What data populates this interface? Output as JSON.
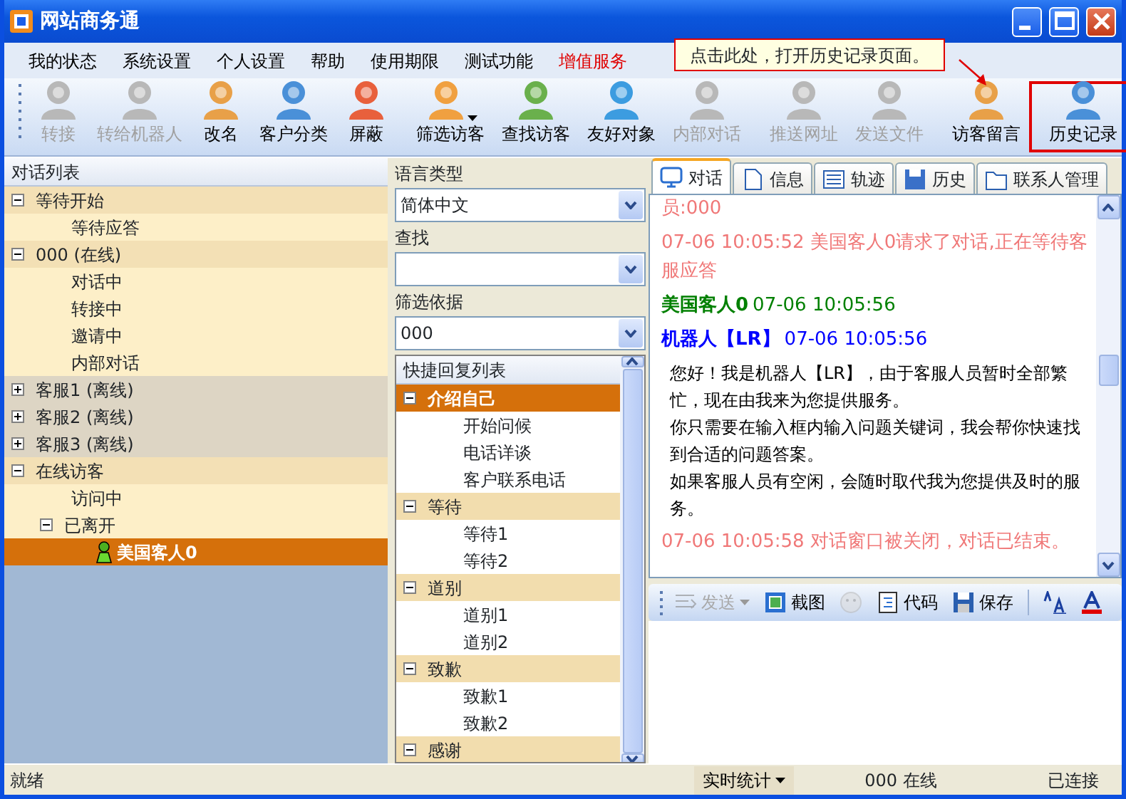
{
  "window": {
    "title": "网站商务通"
  },
  "menu": [
    {
      "label": "我的状态",
      "promoted": false
    },
    {
      "label": "系统设置",
      "promoted": false
    },
    {
      "label": "个人设置",
      "promoted": false
    },
    {
      "label": "帮助",
      "promoted": false
    },
    {
      "label": "使用期限",
      "promoted": false
    },
    {
      "label": "测试功能",
      "promoted": false
    },
    {
      "label": "增值服务",
      "promoted": true
    }
  ],
  "callout": {
    "text": "点击此处，打开历史记录页面。"
  },
  "toolbar": [
    {
      "kind": "button",
      "label": "转接",
      "disabled": true,
      "dropdown": false,
      "highlighted": false
    },
    {
      "kind": "button",
      "label": "转给机器人",
      "disabled": true,
      "dropdown": false,
      "highlighted": false
    },
    {
      "kind": "button",
      "label": "改名",
      "disabled": false,
      "dropdown": false,
      "highlighted": false
    },
    {
      "kind": "button",
      "label": "客户分类",
      "disabled": false,
      "dropdown": false,
      "highlighted": false
    },
    {
      "kind": "button",
      "label": "屏蔽",
      "disabled": false,
      "dropdown": false,
      "highlighted": false
    },
    {
      "kind": "separator"
    },
    {
      "kind": "button",
      "label": "筛选访客",
      "disabled": false,
      "dropdown": true,
      "highlighted": false
    },
    {
      "kind": "button",
      "label": "查找访客",
      "disabled": false,
      "dropdown": false,
      "highlighted": false
    },
    {
      "kind": "button",
      "label": "友好对象",
      "disabled": false,
      "dropdown": false,
      "highlighted": false
    },
    {
      "kind": "button",
      "label": "内部对话",
      "disabled": true,
      "dropdown": false,
      "highlighted": false
    },
    {
      "kind": "separator"
    },
    {
      "kind": "button",
      "label": "推送网址",
      "disabled": true,
      "dropdown": false,
      "highlighted": false
    },
    {
      "kind": "button",
      "label": "发送文件",
      "disabled": true,
      "dropdown": false,
      "highlighted": false
    },
    {
      "kind": "separator"
    },
    {
      "kind": "button",
      "label": "访客留言",
      "disabled": false,
      "dropdown": false,
      "highlighted": false
    },
    {
      "kind": "button",
      "label": "历史记录",
      "disabled": false,
      "dropdown": false,
      "highlighted": true
    }
  ],
  "conversation_list": {
    "title": "对话列表",
    "groups": [
      {
        "label": "等待开始",
        "color": "#f3e0b5",
        "expanded": true,
        "selected": false,
        "children": [
          {
            "label": "等待应答",
            "selected": false
          }
        ]
      },
      {
        "label": "000 (在线)",
        "color": "#f3e0b5",
        "expanded": true,
        "selected": false,
        "children": [
          {
            "label": "对话中",
            "selected": false
          },
          {
            "label": "转接中",
            "selected": false
          },
          {
            "label": "邀请中",
            "selected": false
          },
          {
            "label": "内部对话",
            "selected": false
          }
        ]
      },
      {
        "label": "客服1 (离线)",
        "color": "#ddd5c4",
        "expanded": false,
        "selected": false
      },
      {
        "label": "客服2 (离线)",
        "color": "#ddd5c4",
        "expanded": false,
        "selected": false
      },
      {
        "label": "客服3 (离线)",
        "color": "#ddd5c4",
        "expanded": false,
        "selected": false
      },
      {
        "label": "在线访客",
        "color": "#f3e0b5",
        "expanded": true,
        "selected": false,
        "children": [
          {
            "label": "访问中",
            "selected": false
          },
          {
            "label": "已离开",
            "expanded": true,
            "selected": false,
            "children": [
              {
                "label": "美国客人0",
                "kind": "visitor",
                "selected": true
              }
            ]
          }
        ]
      }
    ]
  },
  "filters": [
    {
      "label": "语言类型",
      "value": "简体中文"
    },
    {
      "label": "查找"
    },
    {
      "label": "筛选依据",
      "value": "000"
    }
  ],
  "quick_replies": {
    "title": "快捷回复列表",
    "groups": [
      {
        "label": "介绍自己",
        "expanded": true,
        "selected": true,
        "children": [
          {
            "label": "开始问候",
            "selected": false
          },
          {
            "label": "电话详谈",
            "selected": false
          },
          {
            "label": "客户联系电话",
            "selected": false
          }
        ]
      },
      {
        "label": "等待",
        "expanded": true,
        "selected": false,
        "children": [
          {
            "label": "等待1",
            "selected": false
          },
          {
            "label": "等待2",
            "selected": false
          }
        ]
      },
      {
        "label": "道别",
        "expanded": true,
        "selected": false,
        "children": [
          {
            "label": "道别1",
            "selected": false
          },
          {
            "label": "道别2",
            "selected": false
          }
        ]
      },
      {
        "label": "致歉",
        "expanded": true,
        "selected": false,
        "children": [
          {
            "label": "致歉1",
            "selected": false
          },
          {
            "label": "致歉2",
            "selected": false
          }
        ]
      },
      {
        "label": "感谢",
        "expanded": true,
        "selected": false
      }
    ]
  },
  "tabs": [
    {
      "label": "对话",
      "selected": true
    },
    {
      "label": "信息",
      "selected": false
    },
    {
      "label": "轨迹",
      "selected": false
    },
    {
      "label": "历史",
      "selected": false
    },
    {
      "label": "联系人管理",
      "selected": false
    }
  ],
  "messages": [
    {
      "kind": "system",
      "text": "员:000"
    },
    {
      "kind": "system",
      "time": "07-06 10:05:52",
      "text": "美国客人0请求了对话,正在等待客服应答"
    },
    {
      "kind": "visitor",
      "sender": "美国客人0",
      "time": "07-06 10:05:56"
    },
    {
      "kind": "robot",
      "sender": "机器人【LR】",
      "time": "07-06 10:05:56"
    },
    {
      "kind": "body",
      "lines": [
        "您好！我是机器人【LR】，由于客服人员暂时全部繁忙，现在由我来为您提供服务。",
        "你只需要在输入框内输入问题关键词，我会帮你快速找到合适的问题答案。",
        "如果客服人员有空闲，会随时取代我为您提供及时的服务。"
      ]
    },
    {
      "kind": "system",
      "time": "07-06 10:05:58",
      "text": "对话窗口被关闭，对话已结束。"
    }
  ],
  "input_toolbar": [
    {
      "kind": "send",
      "label": "发送",
      "disabled": true
    },
    {
      "kind": "screenshot",
      "label": "截图",
      "disabled": false
    },
    {
      "kind": "emoji",
      "disabled": true
    },
    {
      "kind": "code",
      "label": "代码",
      "disabled": false
    },
    {
      "kind": "save",
      "label": "保存",
      "disabled": false
    },
    {
      "kind": "separator"
    },
    {
      "kind": "font-size",
      "disabled": false
    },
    {
      "kind": "font-color",
      "disabled": false
    }
  ],
  "status_bar": {
    "message": "就绪",
    "stats": "实时统计",
    "online": "000 在线",
    "connection": "已连接"
  }
}
